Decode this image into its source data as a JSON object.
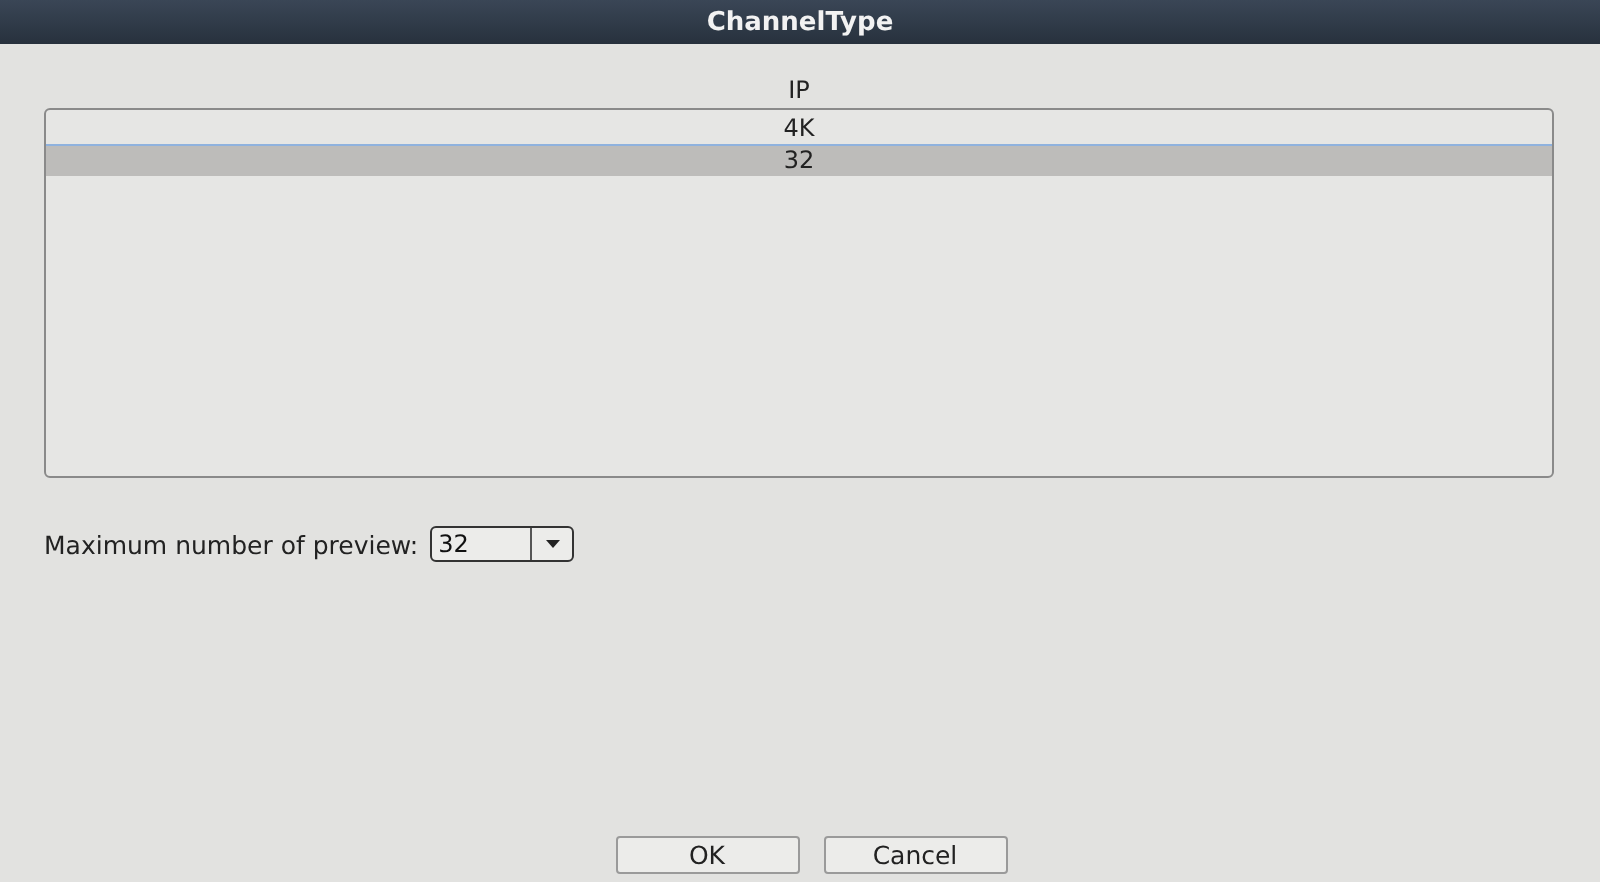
{
  "window": {
    "title": "ChannelType"
  },
  "list": {
    "header": "IP",
    "rows": [
      {
        "label": "4K",
        "selected": false
      },
      {
        "label": "32",
        "selected": true
      }
    ]
  },
  "preview": {
    "label": "Maximum number of preview:",
    "value": "32"
  },
  "buttons": [
    "OK",
    "Cancel"
  ]
}
